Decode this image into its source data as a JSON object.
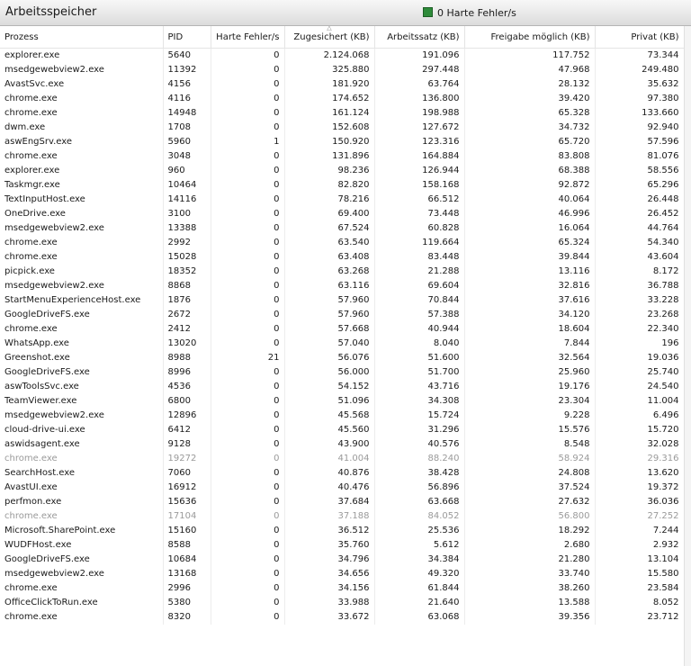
{
  "header": {
    "title": "Arbeitsspeicher",
    "legend_label": "0 Harte Fehler/s",
    "legend_color": "#2e8b3a"
  },
  "table": {
    "columns": [
      "Prozess",
      "PID",
      "Harte Fehler/s",
      "Zugesichert (KB)",
      "Arbeitssatz (KB)",
      "Freigabe möglich (KB)",
      "Privat (KB)"
    ],
    "rows": [
      {
        "cells": [
          "explorer.exe",
          "5640",
          "0",
          "2.124.068",
          "191.096",
          "117.752",
          "73.344"
        ]
      },
      {
        "cells": [
          "msedgewebview2.exe",
          "11392",
          "0",
          "325.880",
          "297.448",
          "47.968",
          "249.480"
        ]
      },
      {
        "cells": [
          "AvastSvc.exe",
          "4156",
          "0",
          "181.920",
          "63.764",
          "28.132",
          "35.632"
        ]
      },
      {
        "cells": [
          "chrome.exe",
          "4116",
          "0",
          "174.652",
          "136.800",
          "39.420",
          "97.380"
        ]
      },
      {
        "cells": [
          "chrome.exe",
          "14948",
          "0",
          "161.124",
          "198.988",
          "65.328",
          "133.660"
        ]
      },
      {
        "cells": [
          "dwm.exe",
          "1708",
          "0",
          "152.608",
          "127.672",
          "34.732",
          "92.940"
        ]
      },
      {
        "cells": [
          "aswEngSrv.exe",
          "5960",
          "1",
          "150.920",
          "123.316",
          "65.720",
          "57.596"
        ]
      },
      {
        "cells": [
          "chrome.exe",
          "3048",
          "0",
          "131.896",
          "164.884",
          "83.808",
          "81.076"
        ]
      },
      {
        "cells": [
          "explorer.exe",
          "960",
          "0",
          "98.236",
          "126.944",
          "68.388",
          "58.556"
        ]
      },
      {
        "cells": [
          "Taskmgr.exe",
          "10464",
          "0",
          "82.820",
          "158.168",
          "92.872",
          "65.296"
        ]
      },
      {
        "cells": [
          "TextInputHost.exe",
          "14116",
          "0",
          "78.216",
          "66.512",
          "40.064",
          "26.448"
        ]
      },
      {
        "cells": [
          "OneDrive.exe",
          "3100",
          "0",
          "69.400",
          "73.448",
          "46.996",
          "26.452"
        ]
      },
      {
        "cells": [
          "msedgewebview2.exe",
          "13388",
          "0",
          "67.524",
          "60.828",
          "16.064",
          "44.764"
        ]
      },
      {
        "cells": [
          "chrome.exe",
          "2992",
          "0",
          "63.540",
          "119.664",
          "65.324",
          "54.340"
        ]
      },
      {
        "cells": [
          "chrome.exe",
          "15028",
          "0",
          "63.408",
          "83.448",
          "39.844",
          "43.604"
        ]
      },
      {
        "cells": [
          "picpick.exe",
          "18352",
          "0",
          "63.268",
          "21.288",
          "13.116",
          "8.172"
        ]
      },
      {
        "cells": [
          "msedgewebview2.exe",
          "8868",
          "0",
          "63.116",
          "69.604",
          "32.816",
          "36.788"
        ]
      },
      {
        "cells": [
          "StartMenuExperienceHost.exe",
          "1876",
          "0",
          "57.960",
          "70.844",
          "37.616",
          "33.228"
        ]
      },
      {
        "cells": [
          "GoogleDriveFS.exe",
          "2672",
          "0",
          "57.960",
          "57.388",
          "34.120",
          "23.268"
        ]
      },
      {
        "cells": [
          "chrome.exe",
          "2412",
          "0",
          "57.668",
          "40.944",
          "18.604",
          "22.340"
        ]
      },
      {
        "cells": [
          "WhatsApp.exe",
          "13020",
          "0",
          "57.040",
          "8.040",
          "7.844",
          "196"
        ]
      },
      {
        "cells": [
          "Greenshot.exe",
          "8988",
          "21",
          "56.076",
          "51.600",
          "32.564",
          "19.036"
        ]
      },
      {
        "cells": [
          "GoogleDriveFS.exe",
          "8996",
          "0",
          "56.000",
          "51.700",
          "25.960",
          "25.740"
        ]
      },
      {
        "cells": [
          "aswToolsSvc.exe",
          "4536",
          "0",
          "54.152",
          "43.716",
          "19.176",
          "24.540"
        ]
      },
      {
        "cells": [
          "TeamViewer.exe",
          "6800",
          "0",
          "51.096",
          "34.308",
          "23.304",
          "11.004"
        ]
      },
      {
        "cells": [
          "msedgewebview2.exe",
          "12896",
          "0",
          "45.568",
          "15.724",
          "9.228",
          "6.496"
        ]
      },
      {
        "cells": [
          "cloud-drive-ui.exe",
          "6412",
          "0",
          "45.560",
          "31.296",
          "15.576",
          "15.720"
        ]
      },
      {
        "cells": [
          "aswidsagent.exe",
          "9128",
          "0",
          "43.900",
          "40.576",
          "8.548",
          "32.028"
        ]
      },
      {
        "cells": [
          "chrome.exe",
          "19272",
          "0",
          "41.004",
          "88.240",
          "58.924",
          "29.316"
        ],
        "dim": true
      },
      {
        "cells": [
          "SearchHost.exe",
          "7060",
          "0",
          "40.876",
          "38.428",
          "24.808",
          "13.620"
        ]
      },
      {
        "cells": [
          "AvastUI.exe",
          "16912",
          "0",
          "40.476",
          "56.896",
          "37.524",
          "19.372"
        ]
      },
      {
        "cells": [
          "perfmon.exe",
          "15636",
          "0",
          "37.684",
          "63.668",
          "27.632",
          "36.036"
        ]
      },
      {
        "cells": [
          "chrome.exe",
          "17104",
          "0",
          "37.188",
          "84.052",
          "56.800",
          "27.252"
        ],
        "dim": true
      },
      {
        "cells": [
          "Microsoft.SharePoint.exe",
          "15160",
          "0",
          "36.512",
          "25.536",
          "18.292",
          "7.244"
        ]
      },
      {
        "cells": [
          "WUDFHost.exe",
          "8588",
          "0",
          "35.760",
          "5.612",
          "2.680",
          "2.932"
        ]
      },
      {
        "cells": [
          "GoogleDriveFS.exe",
          "10684",
          "0",
          "34.796",
          "34.384",
          "21.280",
          "13.104"
        ]
      },
      {
        "cells": [
          "msedgewebview2.exe",
          "13168",
          "0",
          "34.656",
          "49.320",
          "33.740",
          "15.580"
        ]
      },
      {
        "cells": [
          "chrome.exe",
          "2996",
          "0",
          "34.156",
          "61.844",
          "38.260",
          "23.584"
        ]
      },
      {
        "cells": [
          "OfficeClickToRun.exe",
          "5380",
          "0",
          "33.988",
          "21.640",
          "13.588",
          "8.052"
        ]
      },
      {
        "cells": [
          "chrome.exe",
          "8320",
          "0",
          "33.672",
          "63.068",
          "39.356",
          "23.712"
        ]
      }
    ]
  },
  "icons": {
    "sort": "sort-ascending-icon"
  }
}
